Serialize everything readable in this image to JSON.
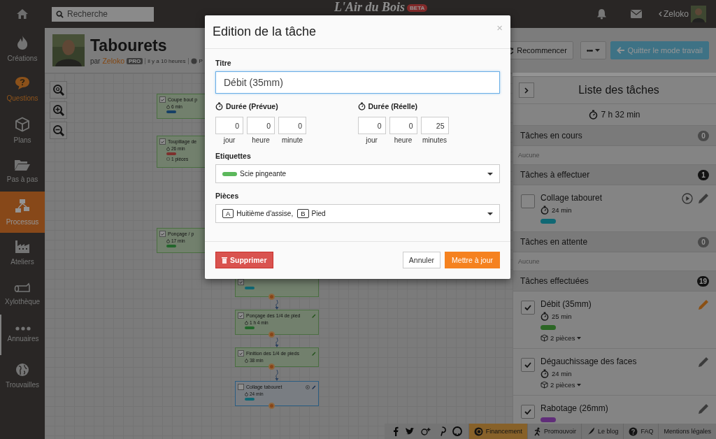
{
  "topbar": {
    "search": {
      "placeholder": "Recherche"
    },
    "logo": "L'Air du Bois",
    "logo_badge": "BETA",
    "user": "Zeloko"
  },
  "sidebar": {
    "items": [
      {
        "label": "Créations",
        "selected": false,
        "accent": false,
        "hovered": false
      },
      {
        "label": "Questions",
        "selected": false,
        "accent": true,
        "hovered": false
      },
      {
        "label": "Plans",
        "selected": false,
        "accent": false,
        "hovered": false
      },
      {
        "label": "Pas à pas",
        "selected": false,
        "accent": false,
        "hovered": false
      },
      {
        "label": "Processus",
        "selected": true,
        "accent": false,
        "hovered": false
      },
      {
        "label": "Ateliers",
        "selected": false,
        "accent": false,
        "hovered": false
      },
      {
        "label": "Xylothèque",
        "selected": false,
        "accent": false,
        "hovered": false
      },
      {
        "label": "Annuaires",
        "selected": false,
        "accent": false,
        "hovered": true
      },
      {
        "label": "Trouvailles",
        "selected": false,
        "accent": false,
        "hovered": false
      }
    ]
  },
  "project": {
    "title": "Tabourets",
    "by": "par",
    "author": "Zeloko",
    "author_badge": "PRO",
    "time": "il y a 10 heures",
    "visibility": "P"
  },
  "actions": {
    "restart": "Recommencer",
    "more": "•••",
    "quit": "Quitter le mode travail"
  },
  "canvas": {
    "nodes": [
      {
        "title": "Coupe bout p",
        "duration": "6 min",
        "checked": true,
        "color": "#184066"
      },
      {
        "title": "Toupillage de",
        "duration": "26 min",
        "checked": true,
        "color": "#7e302e",
        "pieces": "1 pièces"
      },
      {
        "title": "Ponçage / p",
        "duration": "17 min",
        "checked": true,
        "color": "#23662b"
      },
      {
        "checked": true,
        "color": "#106874"
      },
      {
        "title": "Ponçage des 1/4 de pied",
        "duration": "1 h 4 min",
        "checked": true,
        "color": "#23662b"
      },
      {
        "title": "Finition des 1/4 de pieds",
        "duration": "38 min",
        "checked": true
      },
      {
        "title": "Collage tabouret",
        "duration": "24 min",
        "checked": false,
        "color": "#106874"
      }
    ]
  },
  "task_list": {
    "title": "Liste des tâches",
    "total": "7 h 32 min",
    "sections": [
      {
        "title": "Tâches en cours",
        "count": "0",
        "color": "#4a4a4a",
        "empty_text": "Aucune"
      },
      {
        "title": "Tâches à effectuer",
        "count": "1",
        "color": "#141414",
        "tasks": [
          {
            "title": "Collage tabouret",
            "duration": "24 min",
            "checked": false,
            "playable": true,
            "editing": false,
            "color": "#106874"
          }
        ]
      },
      {
        "title": "Tâches en attente",
        "count": "0",
        "color": "#4a4a4a",
        "empty_text": "Aucune"
      },
      {
        "title": "Tâches effectuées",
        "count": "19",
        "color": "#141414",
        "tasks": [
          {
            "title": "Débit (35mm)",
            "duration": "25 min",
            "checked": true,
            "playable": false,
            "editing": true,
            "color": "#2c6625",
            "pieces": "2 pièces"
          },
          {
            "title": "Dégauchissage des faces",
            "duration": "24 min",
            "checked": true,
            "playable": false,
            "editing": false,
            "pieces": "2 pièces"
          },
          {
            "title": "Rabotage (26mm)",
            "checked": true,
            "playable": false,
            "editing": false,
            "color": "#602e79"
          }
        ]
      }
    ]
  },
  "footer": {
    "links": [
      {
        "label": "Financement",
        "highlighted": true
      },
      {
        "label": "Promouvoir",
        "highlighted": false
      },
      {
        "label": "Le blog",
        "highlighted": false
      },
      {
        "label": "FAQ",
        "highlighted": false
      },
      {
        "label": "Mentions légales",
        "highlighted": false
      }
    ]
  },
  "dialog": {
    "title": "Edition de la tâche",
    "close": "×",
    "title_label": "Titre",
    "title_value": "Débit (35mm)",
    "durations": [
      {
        "label": "Durée (Prévue)",
        "parts": [
          {
            "value": "0",
            "unit": "jour"
          },
          {
            "value": "0",
            "unit": "heure"
          },
          {
            "value": "0",
            "unit": "minute"
          }
        ]
      },
      {
        "label": "Durée (Réelle)",
        "parts": [
          {
            "value": "0",
            "unit": "jour"
          },
          {
            "value": "0",
            "unit": "heure"
          },
          {
            "value": "25",
            "unit": "minutes"
          }
        ]
      }
    ],
    "tags": {
      "label": "Etiquettes",
      "value": "Scie pingeante",
      "color": "#5cb85c"
    },
    "pieces": {
      "label": "Pièces",
      "items": [
        {
          "key": "A",
          "name": "Huitième d'assise,"
        },
        {
          "key": "B",
          "name": "Pied"
        }
      ]
    },
    "delete": "Supprimer",
    "cancel": "Annuler",
    "submit": "Mettre à jour"
  }
}
